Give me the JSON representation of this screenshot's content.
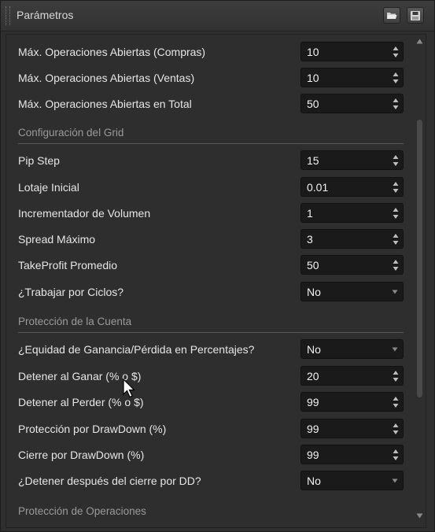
{
  "window": {
    "title": "Parámetros"
  },
  "toolbar": {
    "open_icon": "folder-open-icon",
    "save_icon": "save-icon"
  },
  "params_top": [
    {
      "label": "Máx. Operaciones Abiertas (Compras)",
      "value": "10",
      "kind": "spin"
    },
    {
      "label": "Máx. Operaciones Abiertas (Ventas)",
      "value": "10",
      "kind": "spin"
    },
    {
      "label": "Máx. Operaciones Abiertas en Total",
      "value": "50",
      "kind": "spin"
    }
  ],
  "section_grid": "Configuración del Grid",
  "params_grid": [
    {
      "label": "Pip Step",
      "value": "15",
      "kind": "spin"
    },
    {
      "label": "Lotaje Inicial",
      "value": "0.01",
      "kind": "spin"
    },
    {
      "label": "Incrementador de Volumen",
      "value": "1",
      "kind": "spin"
    },
    {
      "label": "Spread Máximo",
      "value": "3",
      "kind": "spin"
    },
    {
      "label": "TakeProfit Promedio",
      "value": "50",
      "kind": "spin"
    },
    {
      "label": "¿Trabajar por Ciclos?",
      "value": "No",
      "kind": "select"
    }
  ],
  "section_account": "Protección de la Cuenta",
  "params_account": [
    {
      "label": "¿Equidad de Ganancia/Pérdida en Percentajes?",
      "value": "No",
      "kind": "select"
    },
    {
      "label": "Detener al Ganar (% o $)",
      "value": "20",
      "kind": "spin"
    },
    {
      "label": "Detener al Perder (% o $)",
      "value": "99",
      "kind": "spin"
    },
    {
      "label": "Protección por DrawDown (%)",
      "value": "99",
      "kind": "spin"
    },
    {
      "label": "Cierre por DrawDown (%)",
      "value": "99",
      "kind": "spin"
    },
    {
      "label": "¿Detener después del cierre por DD?",
      "value": "No",
      "kind": "select"
    }
  ],
  "section_ops": "Protección de Operaciones"
}
